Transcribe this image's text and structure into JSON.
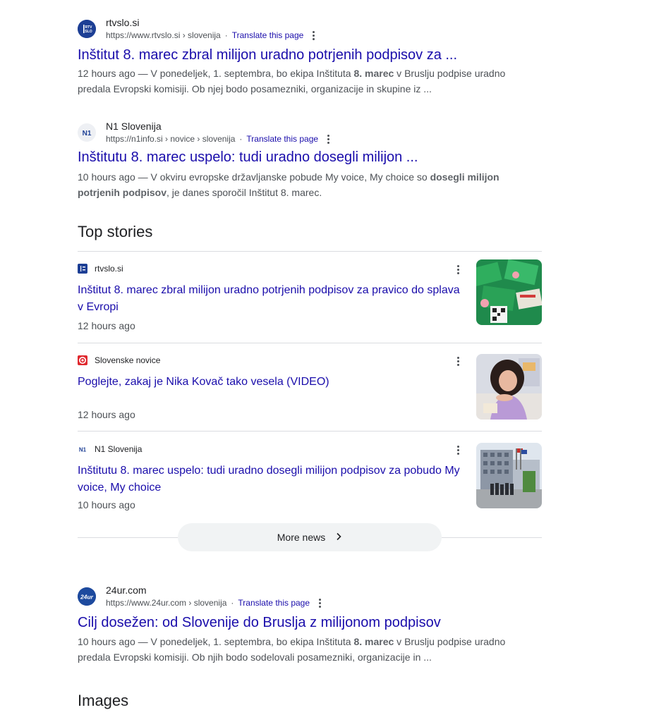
{
  "results": [
    {
      "site_name": "rtvslo.si",
      "url": "https://www.rtvslo.si › slovenija",
      "translate": "Translate this page",
      "favicon_text": "RTV SLO",
      "title": "Inštitut 8. marec zbral milijon uradno potrjenih podpisov za ...",
      "snippet": [
        {
          "t": "12 hours ago — V ponedeljek, 1. septembra, bo ekipa Inštituta ",
          "b": false
        },
        {
          "t": "8. marec",
          "b": true
        },
        {
          "t": " v Bruslju podpise uradno predala Evropski komisiji. Ob njej bodo posamezniki, organizacije in skupine iz ...",
          "b": false
        }
      ]
    },
    {
      "site_name": "N1 Slovenija",
      "url": "https://n1info.si › novice › slovenija",
      "translate": "Translate this page",
      "favicon_text": "N1",
      "title": "Inštitutu 8. marec uspelo: tudi uradno dosegli milijon ...",
      "snippet": [
        {
          "t": "10 hours ago — V okviru evropske državljanske pobude My voice, My choice so ",
          "b": false
        },
        {
          "t": "dosegli milijon potrjenih podpisov",
          "b": true
        },
        {
          "t": ", je danes sporočil Inštitut 8. marec.",
          "b": false
        }
      ]
    },
    {
      "site_name": "24ur.com",
      "url": "https://www.24ur.com › slovenija",
      "translate": "Translate this page",
      "favicon_text": "24ur",
      "title": "Cilj dosežen: od Slovenije do Bruslja z milijonom podpisov",
      "snippet": [
        {
          "t": "10 hours ago — V ponedeljek, 1. septembra, bo ekipa Inštituta ",
          "b": false
        },
        {
          "t": "8. marec",
          "b": true
        },
        {
          "t": " v Bruslju podpise uradno predala Evropski komisiji. Ob njih bodo sodelovali posamezniki, organizacije in ...",
          "b": false
        }
      ]
    }
  ],
  "top_stories": {
    "heading": "Top stories",
    "items": [
      {
        "source": "rtvslo.si",
        "title": "Inštitut 8. marec zbral milijon uradno potrjenih podpisov za pravico do splava v Evropi",
        "time": "12 hours ago"
      },
      {
        "source": "Slovenske novice",
        "title": "Poglejte, zakaj je Nika Kovač tako vesela (VIDEO)",
        "time": "12 hours ago"
      },
      {
        "source": "N1 Slovenija",
        "title": "Inštitutu 8. marec uspelo: tudi uradno dosegli milijon podpisov za pobudo My voice, My choice",
        "time": "10 hours ago"
      }
    ],
    "more_label": "More news"
  },
  "images_heading": "Images",
  "colors": {
    "link": "#1a0dab",
    "text": "#202124",
    "muted": "#4d5156",
    "divider": "#dadce0"
  }
}
